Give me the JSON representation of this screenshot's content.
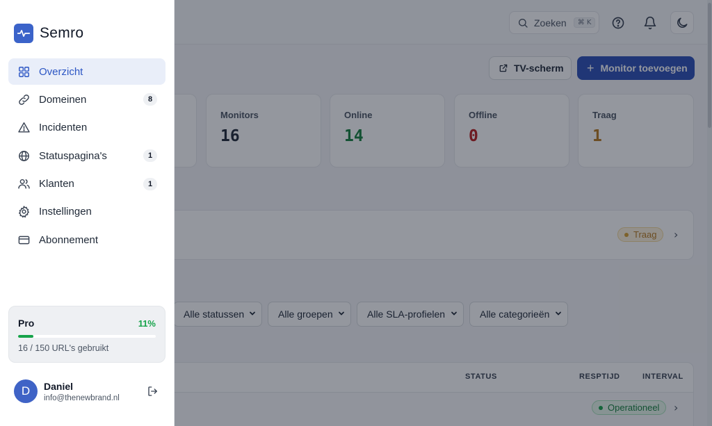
{
  "header": {
    "search_label": "Zoeken",
    "search_shortcut": "⌘ K"
  },
  "actions": {
    "tv_label": "TV-scherm",
    "add_label": "Monitor toevoegen",
    "add_plus": "+"
  },
  "stats": [
    {
      "label": "Monitors",
      "value": "16",
      "color": "#1f2937"
    },
    {
      "label": "Online",
      "value": "14",
      "color": "#15803d"
    },
    {
      "label": "Offline",
      "value": "0",
      "color": "#b91c1c"
    },
    {
      "label": "Traag",
      "value": "1",
      "color": "#b7791f"
    }
  ],
  "incident": {
    "badge": "Traag",
    "badge_color": "#b7791f"
  },
  "filters": [
    "Alle statussen",
    "Alle groepen",
    "Alle SLA-profielen",
    "Alle categorieën"
  ],
  "table": {
    "columns": [
      "STATUS",
      "RESPTIJD",
      "INTERVAL"
    ],
    "first_row_status": "Operationeel",
    "status_color": "#16a34a"
  },
  "sidebar": {
    "brand": "Semro",
    "items": [
      {
        "label": "Overzicht",
        "icon": "grid-icon",
        "active": true,
        "count": ""
      },
      {
        "label": "Domeinen",
        "icon": "link-icon",
        "active": false,
        "count": "8"
      },
      {
        "label": "Incidenten",
        "icon": "warning-icon",
        "active": false,
        "count": ""
      },
      {
        "label": "Statuspagina's",
        "icon": "globe-icon",
        "active": false,
        "count": "1"
      },
      {
        "label": "Klanten",
        "icon": "users-icon",
        "active": false,
        "count": "1"
      },
      {
        "label": "Instellingen",
        "icon": "gear-icon",
        "active": false,
        "count": ""
      },
      {
        "label": "Abonnement",
        "icon": "credit-card-icon",
        "active": false,
        "count": ""
      }
    ]
  },
  "plan": {
    "name": "Pro",
    "percent_label": "11%",
    "usage_fraction": 0.11,
    "usage": "16 / 150 URL's gebruikt"
  },
  "user": {
    "initial": "D",
    "name": "Daniel",
    "email": "info@thenewbrand.nl"
  },
  "colors": {
    "accent": "#2c4fb6",
    "active_nav_bg": "#e9eef9",
    "success": "#16a34a"
  }
}
